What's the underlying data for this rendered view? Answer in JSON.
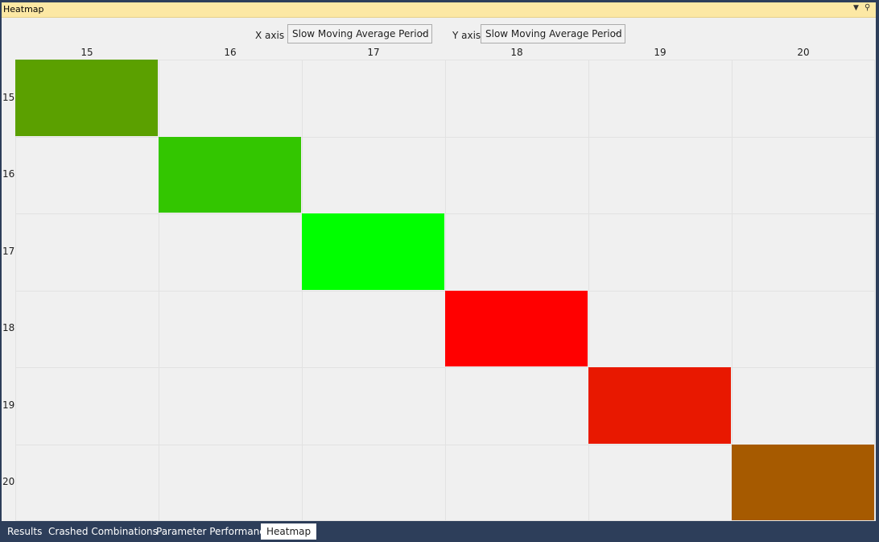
{
  "panel": {
    "title": "Heatmap",
    "dropdown_icon": "▼",
    "pin_icon": "⚲"
  },
  "controls": {
    "x_axis_label": "X axis",
    "x_axis_value": "Slow Moving Average Period",
    "y_axis_label": "Y axis",
    "y_axis_value": "Slow Moving Average Period",
    "chevron": "⌄"
  },
  "chart_data": {
    "type": "heatmap",
    "x_categories": [
      "15",
      "16",
      "17",
      "18",
      "19",
      "20"
    ],
    "y_categories": [
      "15",
      "16",
      "17",
      "18",
      "19",
      "20"
    ],
    "cells": [
      {
        "x": "15",
        "y": "15",
        "color": "#5ba000"
      },
      {
        "x": "16",
        "y": "16",
        "color": "#33c600"
      },
      {
        "x": "17",
        "y": "17",
        "color": "#00ff00"
      },
      {
        "x": "18",
        "y": "18",
        "color": "#ff0000"
      },
      {
        "x": "19",
        "y": "19",
        "color": "#e81800"
      },
      {
        "x": "20",
        "y": "20",
        "color": "#a65a00"
      }
    ],
    "empty_color": "#f0f0f0",
    "grid": true
  },
  "tabs": [
    {
      "label": "Results",
      "active": false
    },
    {
      "label": "Crashed Combinations",
      "active": false
    },
    {
      "label": "Parameter Performance",
      "active": false
    },
    {
      "label": "Heatmap",
      "active": true
    }
  ]
}
